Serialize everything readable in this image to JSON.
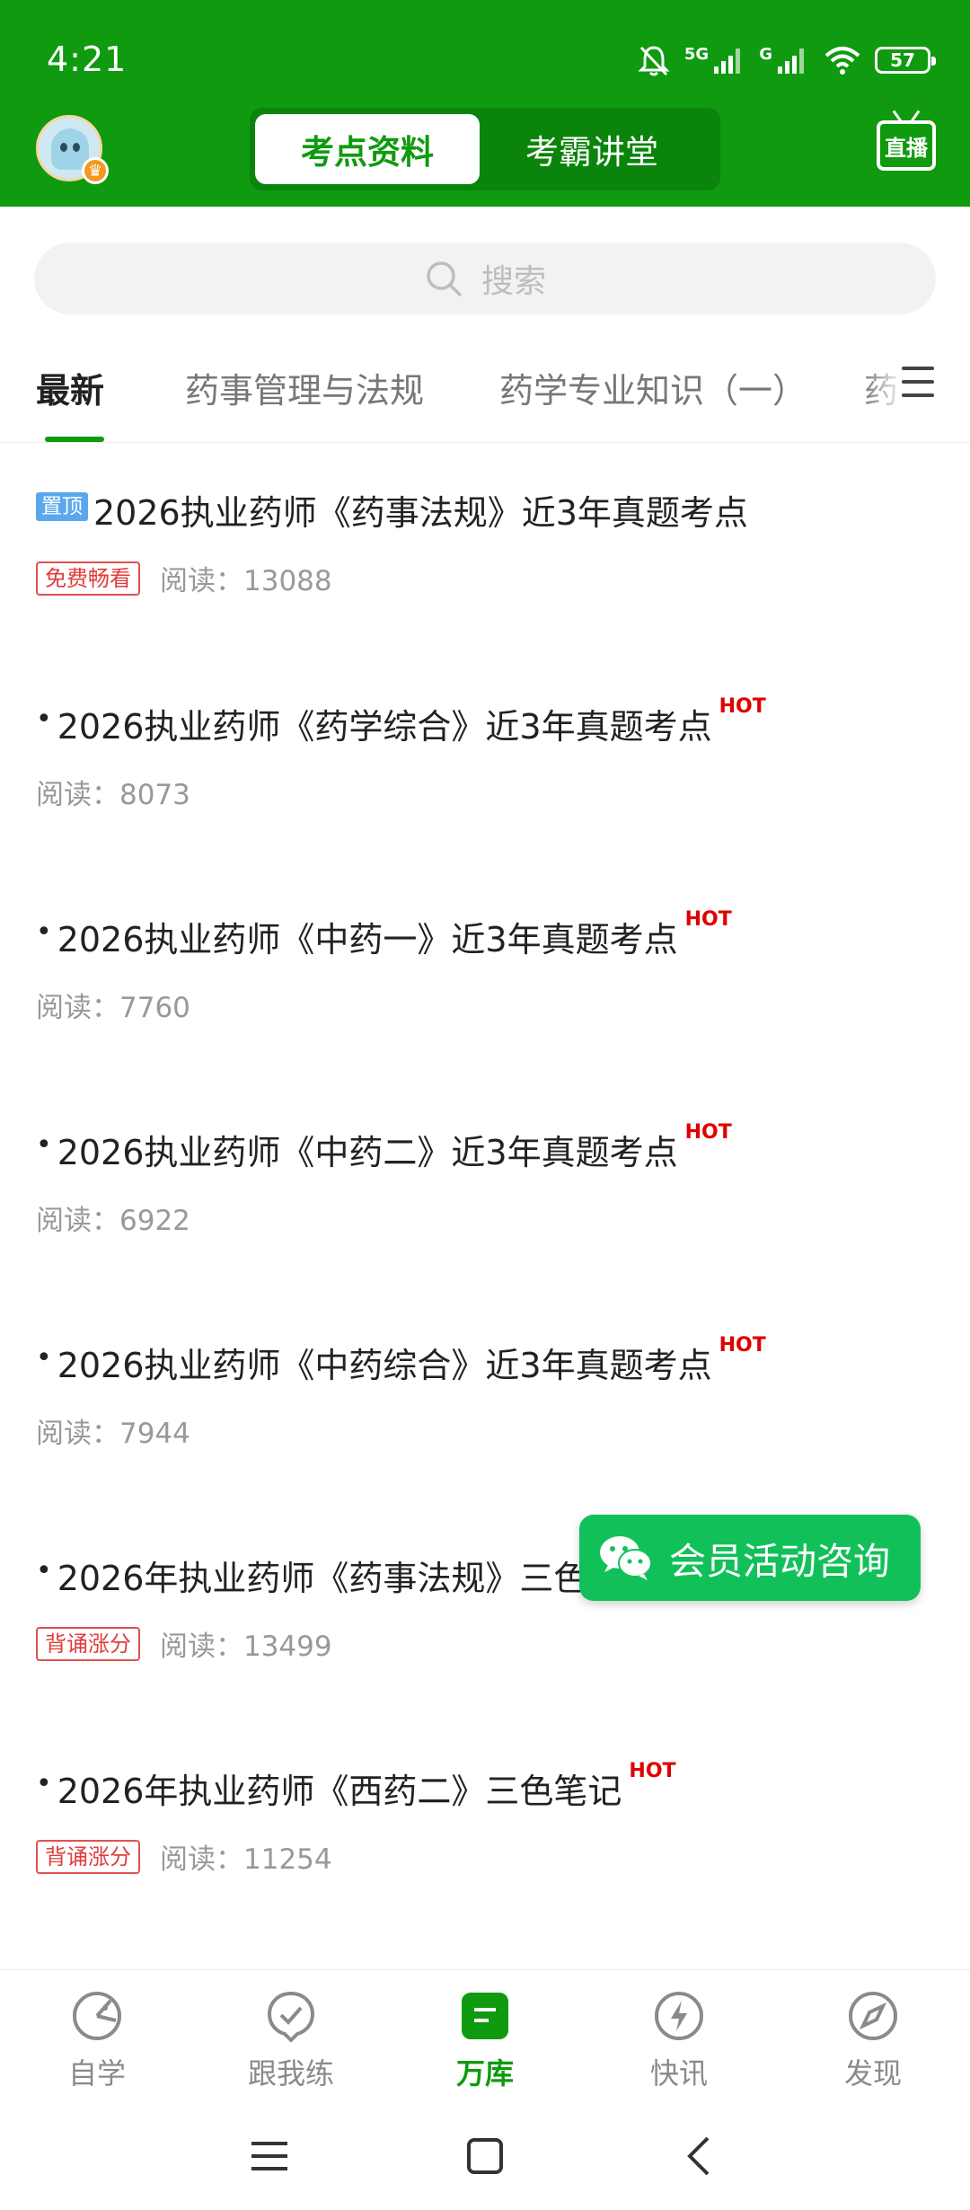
{
  "status": {
    "time": "4:21",
    "battery": "57",
    "net1": "5G",
    "net2": "G"
  },
  "header": {
    "tabs": [
      {
        "label": "考点资料",
        "active": true
      },
      {
        "label": "考霸讲堂",
        "active": false
      }
    ],
    "live_label": "直播"
  },
  "search": {
    "placeholder": "搜索"
  },
  "categories": {
    "tabs": [
      {
        "label": "最新",
        "active": true
      },
      {
        "label": "药事管理与法规"
      },
      {
        "label": "药学专业知识（一）"
      },
      {
        "label": "药"
      }
    ]
  },
  "list": [
    {
      "pinned": true,
      "pin_label": "置顶",
      "title": "2026执业药师《药事法规》近3年真题考点",
      "tag": "免费畅看",
      "reads": "阅读：13088"
    },
    {
      "title": "2026执业药师《药学综合》近3年真题考点",
      "hot": "HOT",
      "reads": "阅读：8073"
    },
    {
      "title": "2026执业药师《中药一》近3年真题考点",
      "hot": "HOT",
      "reads": "阅读：7760"
    },
    {
      "title": "2026执业药师《中药二》近3年真题考点",
      "hot": "HOT",
      "reads": "阅读：6922"
    },
    {
      "title": "2026执业药师《中药综合》近3年真题考点",
      "hot": "HOT",
      "reads": "阅读：7944"
    },
    {
      "title": "2026年执业药师《药事法规》三色",
      "tag": "背诵涨分",
      "reads": "阅读：13499"
    },
    {
      "title": "2026年执业药师《西药二》三色笔记",
      "hot": "HOT",
      "tag": "背诵涨分",
      "reads": "阅读：11254"
    }
  ],
  "consult": {
    "label": "会员活动咨询"
  },
  "bottom_nav": [
    {
      "label": "自学",
      "icon": "self-study-icon"
    },
    {
      "label": "跟我练",
      "icon": "practice-icon"
    },
    {
      "label": "万库",
      "icon": "library-icon",
      "active": true
    },
    {
      "label": "快讯",
      "icon": "flash-news-icon"
    },
    {
      "label": "发现",
      "icon": "compass-icon"
    }
  ],
  "colors": {
    "brand": "#0f9a0f",
    "hot": "#e00000",
    "consult": "#12c05a"
  }
}
